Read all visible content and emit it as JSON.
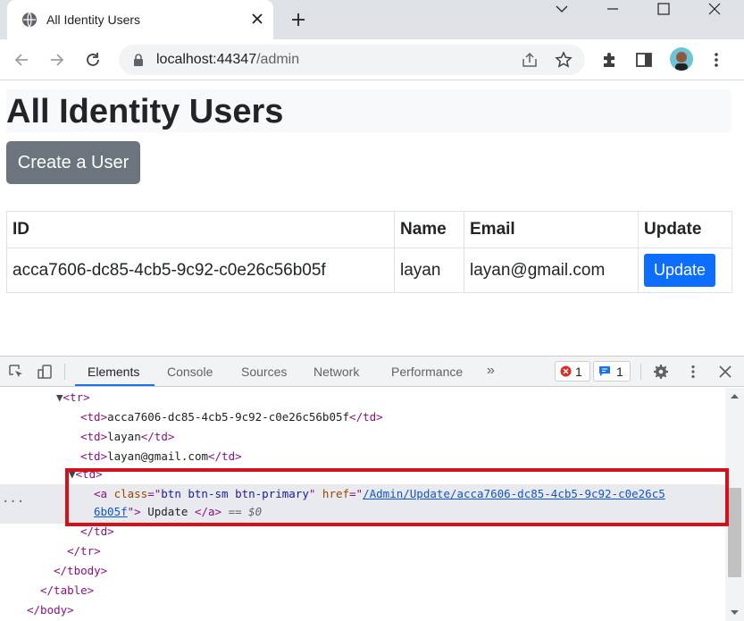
{
  "browser": {
    "tab_title": "All Identity Users",
    "url_host": "localhost:44347",
    "url_path": "/admin"
  },
  "page": {
    "title": "All Identity Users",
    "create_button": "Create a User",
    "table": {
      "headers": [
        "ID",
        "Name",
        "Email",
        "Update"
      ],
      "rows": [
        {
          "id": "acca7606-dc85-4cb5-9c92-c0e26c56b05f",
          "name": "layan",
          "email": "layan@gmail.com",
          "action": "Update"
        }
      ]
    }
  },
  "devtools": {
    "tabs": [
      "Elements",
      "Console",
      "Sources",
      "Network",
      "Performance"
    ],
    "more": "»",
    "error_count": "1",
    "message_count": "1",
    "dom": {
      "tr_open": "<tr>",
      "td1": "acca7606-dc85-4cb5-9c92-c0e26c56b05f",
      "td2": "layan",
      "td3": "layan@gmail.com",
      "td_open": "<td>",
      "a_class": "btn btn-sm btn-primary",
      "a_href_1": "/Admin/Update/acca7606-dc85-4cb5-9c92-c0e26c5",
      "a_href_2": "6b05f",
      "a_text": " Update ",
      "eq0": "== $0",
      "td_close": "</td>",
      "tr_close": "</tr>",
      "tbody_close": "</tbody>",
      "table_close": "</table>",
      "body_close": "</body>"
    }
  },
  "colors": {
    "primary": "#0d6efd",
    "secondary": "#6c757d",
    "highlight_border": "#d4111b",
    "devtools_accent": "#1a73e8"
  }
}
